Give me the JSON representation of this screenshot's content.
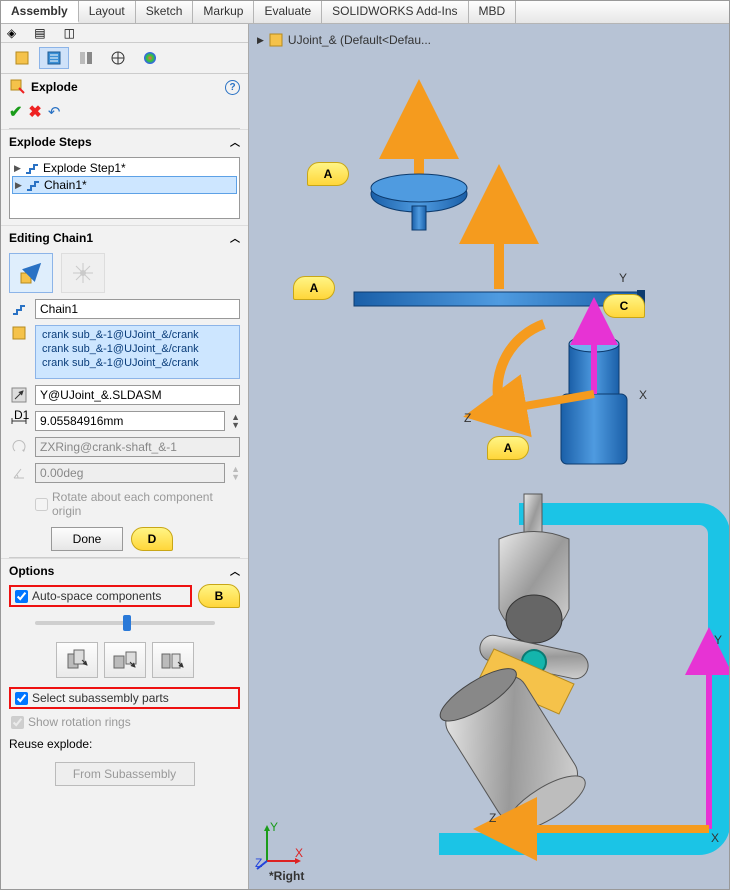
{
  "tabs": [
    "Assembly",
    "Layout",
    "Sketch",
    "Markup",
    "Evaluate",
    "SOLIDWORKS Add-Ins",
    "MBD"
  ],
  "activeTab": 0,
  "feature": {
    "title": "Explode"
  },
  "stepsHeader": "Explode Steps",
  "steps": {
    "items": [
      "Explode Step1*",
      "Chain1*"
    ],
    "selected": 1
  },
  "editingHeader": "Editing Chain1",
  "editing": {
    "name": "Chain1",
    "components": [
      "crank sub_&-1@UJoint_&/crank",
      "crank sub_&-1@UJoint_&/crank",
      "crank sub_&-1@UJoint_&/crank"
    ],
    "direction": "Y@UJoint_&.SLDASM",
    "distance": "9.05584916mm",
    "ring": "ZXRing@crank-shaft_&-1",
    "angle": "0.00deg",
    "rotateEach": "Rotate about each component origin",
    "done": "Done"
  },
  "optionsHeader": "Options",
  "options": {
    "autoSpace": "Auto-space components",
    "selectSub": "Select subassembly parts",
    "showRings": "Show rotation rings",
    "reuse": "Reuse explode:",
    "fromSub": "From Subassembly"
  },
  "crumb": "UJoint_&  (Default<Defau...",
  "viewname": "*Right",
  "callouts": {
    "a": "A",
    "b": "B",
    "c": "C",
    "d": "D"
  },
  "axes": {
    "x": "X",
    "y": "Y",
    "z": "Z"
  }
}
